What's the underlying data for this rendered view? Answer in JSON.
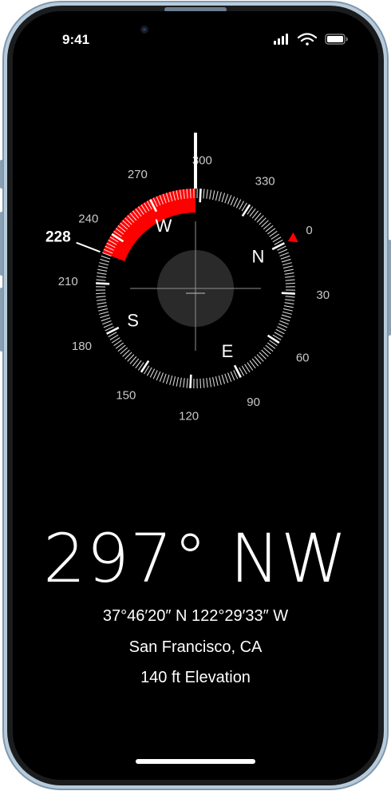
{
  "status_bar": {
    "time": "9:41"
  },
  "compass": {
    "current_heading_deg": 297,
    "bearing_lock_deg": 228,
    "bearing_label": "228",
    "cardinals": [
      "N",
      "E",
      "S",
      "W"
    ],
    "degree_labels": [
      "0",
      "30",
      "60",
      "90",
      "120",
      "150",
      "180",
      "210",
      "240",
      "270",
      "300",
      "330"
    ],
    "accent_color": "#ff0000"
  },
  "readout": {
    "heading": "297° NW",
    "coordinates": "37°46′20″ N  122°29′33″ W",
    "location": "San Francisco, CA",
    "elevation": "140 ft Elevation"
  },
  "icons": [
    "cellular-signal-icon",
    "wifi-icon",
    "battery-icon",
    "front-camera-icon"
  ]
}
